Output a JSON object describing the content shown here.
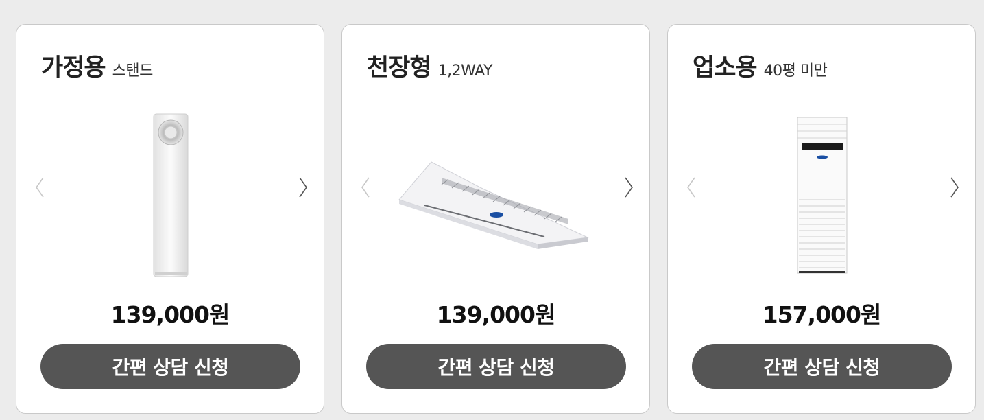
{
  "cards": [
    {
      "title": "가정용",
      "subtitle": "스탠드",
      "price": "139,000원",
      "cta_label": "간편 상담 신청",
      "prev_icon": "chevron-left-icon",
      "next_icon": "chevron-right-icon",
      "image": "standing-air-conditioner-home"
    },
    {
      "title": "천장형",
      "subtitle": "1,2WAY",
      "price": "139,000원",
      "cta_label": "간편 상담 신청",
      "prev_icon": "chevron-left-icon",
      "next_icon": "chevron-right-icon",
      "image": "ceiling-cassette-air-conditioner"
    },
    {
      "title": "업소용",
      "subtitle": "40평 미만",
      "price": "157,000원",
      "cta_label": "간편 상담 신청",
      "prev_icon": "chevron-left-icon",
      "next_icon": "chevron-right-icon",
      "image": "standing-air-conditioner-commercial"
    }
  ],
  "colors": {
    "page_background": "#ececec",
    "card_background": "#ffffff",
    "button_background": "#555555",
    "button_text": "#ffffff"
  }
}
